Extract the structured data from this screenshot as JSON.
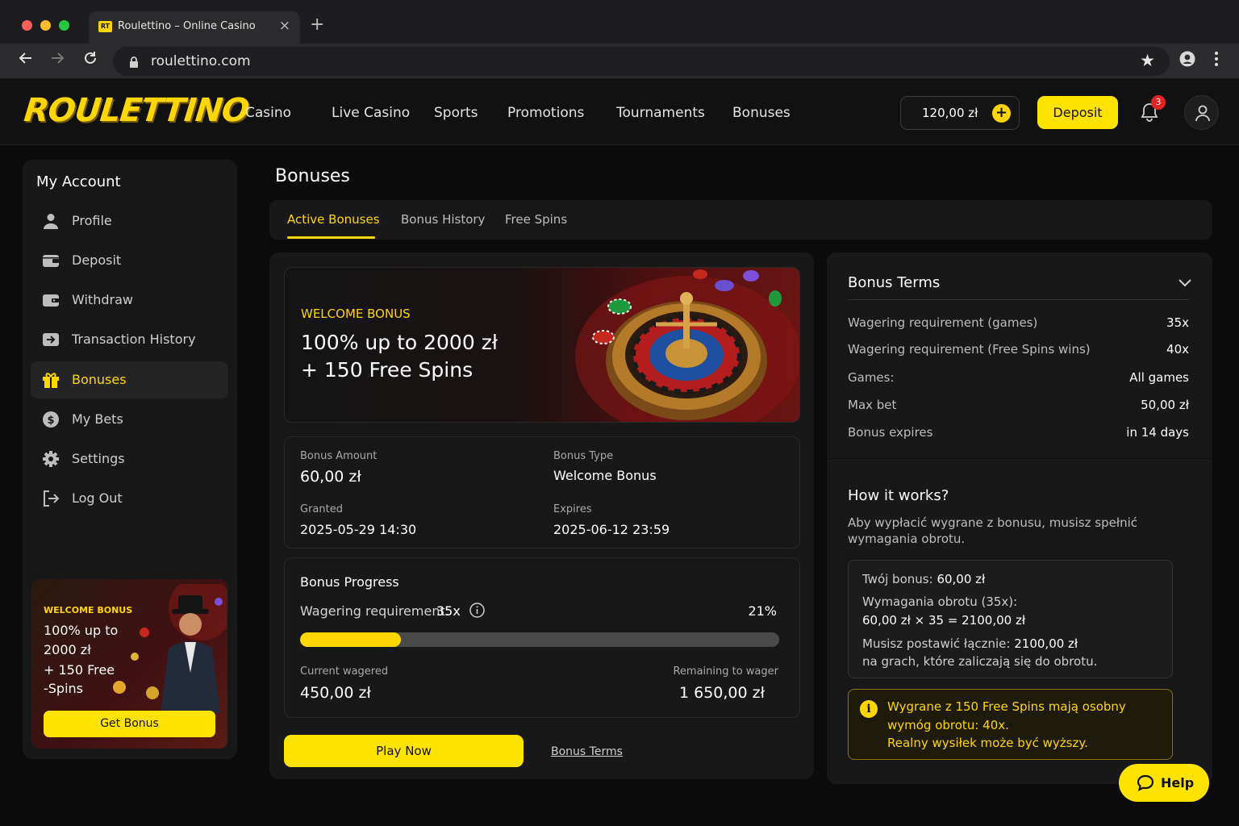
{
  "browser": {
    "tab_title": "Roulettino – Online Casino",
    "favicon_text": "RT",
    "url": "roulettino.com"
  },
  "header": {
    "logo": "ROULETTINO",
    "nav": [
      "Casino",
      "Live Casino",
      "Sports",
      "Promotions",
      "Tournaments",
      "Bonuses"
    ],
    "balance": "120,00 zł",
    "deposit_label": "Deposit",
    "notifications_count": "3"
  },
  "sidebar": {
    "title": "My Account",
    "items": [
      {
        "label": "Profile",
        "icon": "user-icon"
      },
      {
        "label": "Deposit",
        "icon": "wallet-icon"
      },
      {
        "label": "Withdraw",
        "icon": "wallet-out-icon"
      },
      {
        "label": "Transaction History",
        "icon": "transfer-icon"
      },
      {
        "label": "Bonuses",
        "icon": "gift-icon",
        "active": true
      },
      {
        "label": "My Bets",
        "icon": "coin-icon"
      },
      {
        "label": "Settings",
        "icon": "gear-icon"
      },
      {
        "label": "Log Out",
        "icon": "logout-icon"
      }
    ],
    "promo": {
      "tag": "WELCOME BONUS",
      "lines": [
        "100% up to",
        "2000 zł",
        "+ 150 Free",
        "-Spins"
      ],
      "button": "Get Bonus"
    }
  },
  "main": {
    "title": "Bonuses",
    "tabs": [
      {
        "label": "Active Bonuses",
        "active": true
      },
      {
        "label": "Bonus History"
      },
      {
        "label": "Free Spins"
      }
    ],
    "banner": {
      "tag": "WELCOME BONUS",
      "line1": "100% up to 2000 zł",
      "line2": "+ 150 Free Spins"
    },
    "details": {
      "amount_label": "Bonus Amount",
      "amount": "60,00 zł",
      "type_label": "Bonus Type",
      "type": "Welcome Bonus",
      "granted_label": "Granted",
      "granted": "2025-05-29 14:30",
      "expires_label": "Expires",
      "expires": "2025-06-12 23:59"
    },
    "progress": {
      "title": "Bonus Progress",
      "req_label": "Wagering requirement:",
      "req_value": "35x",
      "percent_label": "21%",
      "percent": 0.21,
      "current_label": "Current wagered",
      "current": "450,00 zł",
      "remaining_label": "Remaining to wager",
      "remaining": "1 650,00 zł"
    },
    "play_label": "Play Now",
    "terms_link": "Bonus Terms"
  },
  "terms": {
    "title": "Bonus Terms",
    "rows": [
      {
        "k": "Wagering requirement (games)",
        "v": "35x"
      },
      {
        "k": "Wagering requirement (Free Spins wins)",
        "v": "40x"
      },
      {
        "k": "Games:",
        "v": "All games"
      },
      {
        "k": "Max bet",
        "v": "50,00 zł"
      },
      {
        "k": "Bonus expires",
        "v": "in 14 days"
      }
    ],
    "how_title": "How it works?",
    "how_desc": "Aby wypłacić wygrane z bonusu, musisz spełnić wymagania obrotu.",
    "calc": {
      "l1_label": "Twój bonus:",
      "l1_value": "60,00 zł",
      "l2": "Wymagania obrotu (35x):",
      "l3": "60,00 zł × 35 = 2100,00 zł",
      "l4_label": "Musisz postawić łącznie:",
      "l4_value": "2100,00 zł",
      "l5": "na grach, które zaliczają się do obrotu."
    },
    "warning": [
      "Wygrane z 150 Free Spins mają osobny",
      "wymóg obrotu: 40x.",
      "Realny wysiłek może być wyższy."
    ]
  },
  "help_label": "Help",
  "colors": {
    "accent": "#ffd600",
    "background": "#0b0b0b",
    "card": "#181818",
    "badge": "#e32222"
  }
}
